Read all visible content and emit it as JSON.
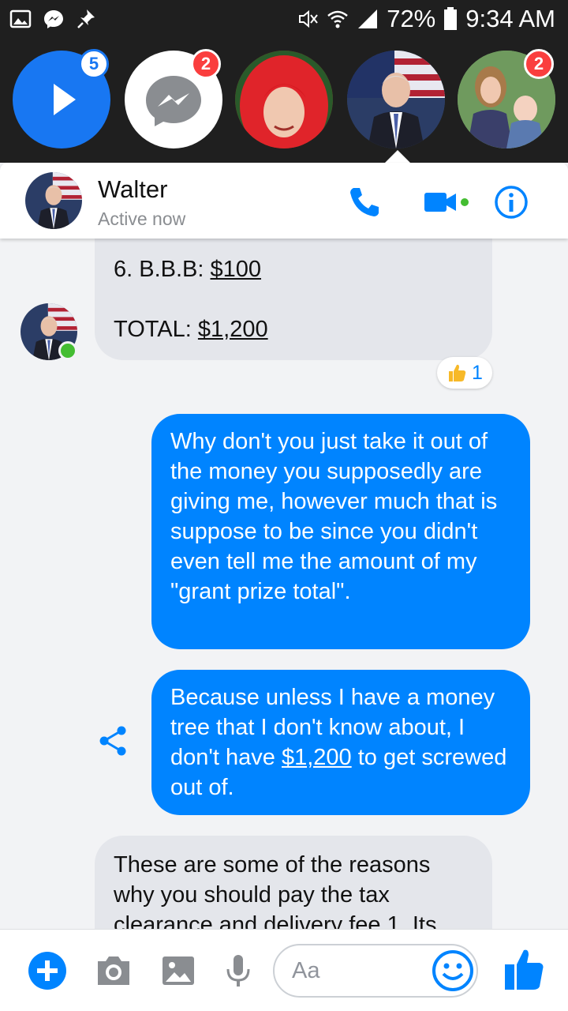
{
  "status_bar": {
    "battery": "72%",
    "time": "9:34 AM",
    "icons": [
      "gallery-icon",
      "messenger-icon",
      "pin-icon",
      "mute-icon",
      "wifi-icon",
      "signal-icon",
      "battery-icon"
    ]
  },
  "chat_heads": [
    {
      "name": "play-head",
      "badge": "5"
    },
    {
      "name": "messenger-head",
      "badge": "2"
    },
    {
      "name": "red-hair-head",
      "badge": ""
    },
    {
      "name": "walter-head",
      "badge": ""
    },
    {
      "name": "family-head",
      "badge": "2"
    }
  ],
  "header": {
    "name": "Walter",
    "status": "Active now",
    "icons": [
      "phone-icon",
      "video-icon",
      "info-icon"
    ],
    "accent": "#0084ff"
  },
  "messages": {
    "incoming_1": {
      "line1_prefix": "6. B.B.B: ",
      "line1_link": "$100",
      "line2_prefix": "TOTAL: ",
      "line2_link": "$1,200",
      "reaction": "1"
    },
    "outgoing_1": "Why don't you just take it out of the money you supposedly are giving me, however much that is suppose to be since you didn't even tell me the amount of my \"grant prize total\".",
    "outgoing_2": {
      "before": "Because unless I have a money tree that I don't know about, I don't have ",
      "link": "$1,200",
      "after": " to get screwed out of."
    },
    "incoming_2": "These are some of the reasons why you should pay the tax clearance and delivery fee 1. Its"
  },
  "composer": {
    "placeholder": "Aa",
    "icons": [
      "plus-icon",
      "camera-icon",
      "image-icon",
      "microphone-icon",
      "emoji-icon",
      "like-icon"
    ]
  },
  "colors": {
    "messenger_blue": "#0084ff",
    "badge_red": "#fa3e3e",
    "incoming_bubble": "#e4e6eb",
    "online_green": "#44bd32"
  }
}
